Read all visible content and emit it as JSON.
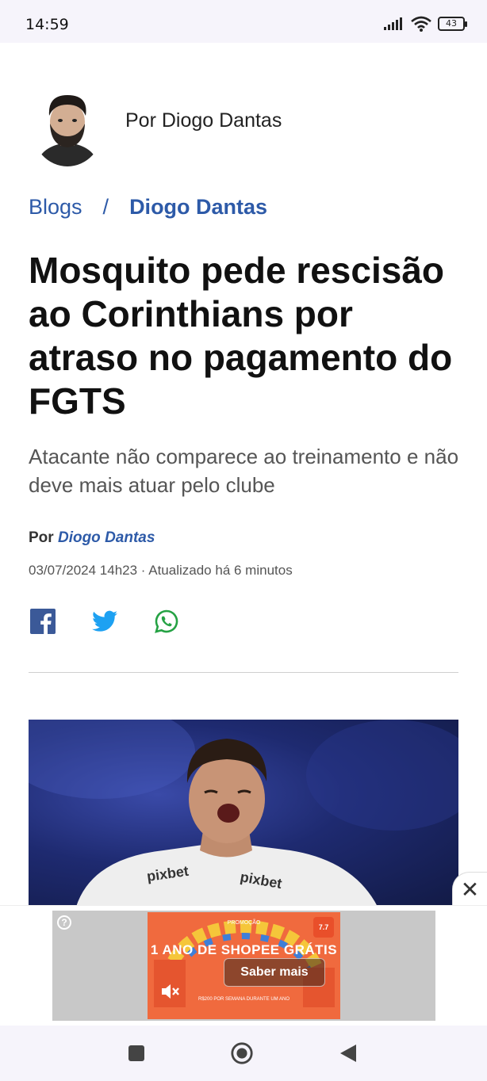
{
  "status_bar": {
    "time": "14:59",
    "battery": "43",
    "icons": [
      "signal-icon",
      "wifi-icon",
      "battery-icon"
    ]
  },
  "author_header": {
    "name": "Por Diogo Dantas"
  },
  "breadcrumb": {
    "items": [
      "Blogs",
      "Diogo Dantas"
    ],
    "separator": "/"
  },
  "article": {
    "title": "Mosquito pede rescisão ao Corinthians por atraso no pagamento do FGTS",
    "subtitle": "Atacante não comparece ao treinamento e não deve mais atuar pelo clube",
    "byline_prefix": "Por",
    "byline_author": "Diogo Dantas",
    "dateline": "03/07/2024 14h23 · Atualizado há 6 minutos",
    "share": [
      "facebook-icon",
      "twitter-icon",
      "whatsapp-icon"
    ],
    "image_shirt_text": [
      "pixbet",
      "pixbet"
    ]
  },
  "ad": {
    "close_label": "✕",
    "info_label": "?",
    "promo_label": "PROMOÇÃO",
    "headline": "1 ANO DE SHOPEE GRÁTIS",
    "sub": "R$200 POR SEMANA DURANTE UM ANO",
    "cta": "Saber mais",
    "badge": "7.7"
  },
  "nav_bar": {
    "icons": [
      "recents-icon",
      "home-icon",
      "back-icon"
    ]
  },
  "colors": {
    "link": "#2d5aa8",
    "facebook": "#3b5998",
    "twitter": "#1da1f2",
    "whatsapp": "#25a244",
    "ad_orange": "#f06a3e"
  }
}
